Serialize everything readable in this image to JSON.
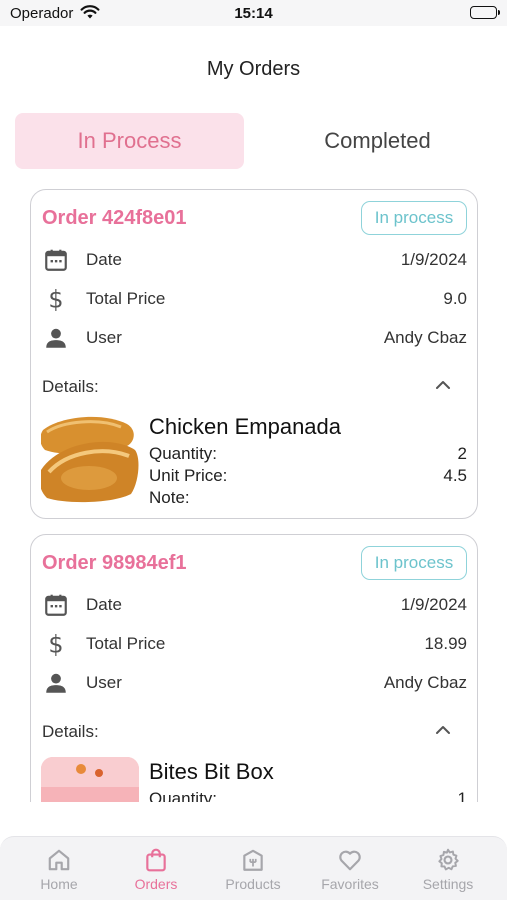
{
  "status_bar": {
    "carrier": "Operador",
    "time": "15:14"
  },
  "header": {
    "title": "My Orders"
  },
  "tabs": [
    {
      "label": "In Process",
      "active": true
    },
    {
      "label": "Completed",
      "active": false
    }
  ],
  "labels": {
    "date": "Date",
    "total_price": "Total Price",
    "user": "User",
    "details": "Details:",
    "quantity": "Quantity:",
    "unit_price": "Unit Price:",
    "note": "Note:"
  },
  "orders": [
    {
      "order_prefix": "Order",
      "order_id": "424f8e01",
      "status": "In process",
      "date": "1/9/2024",
      "total_price": "9.0",
      "user": "Andy Cbaz",
      "items": [
        {
          "name": "Chicken Empanada",
          "quantity": "2",
          "unit_price": "4.5",
          "note": ""
        }
      ]
    },
    {
      "order_prefix": "Order",
      "order_id": "98984ef1",
      "status": "In process",
      "date": "1/9/2024",
      "total_price": "18.99",
      "user": "Andy Cbaz",
      "items": [
        {
          "name": "Bites Bit Box",
          "quantity": "1"
        }
      ]
    }
  ],
  "bottom_nav": [
    {
      "label": "Home",
      "icon": "home-icon",
      "active": false
    },
    {
      "label": "Orders",
      "icon": "shopping-bag-icon",
      "active": true
    },
    {
      "label": "Products",
      "icon": "store-icon",
      "active": false
    },
    {
      "label": "Favorites",
      "icon": "heart-icon",
      "active": false
    },
    {
      "label": "Settings",
      "icon": "gear-icon",
      "active": false
    }
  ],
  "colors": {
    "accent": "#e8719a",
    "tab_active_bg": "#fbe1ea",
    "badge": "#6cc3cc",
    "nav_inactive": "#a6a6ab"
  }
}
